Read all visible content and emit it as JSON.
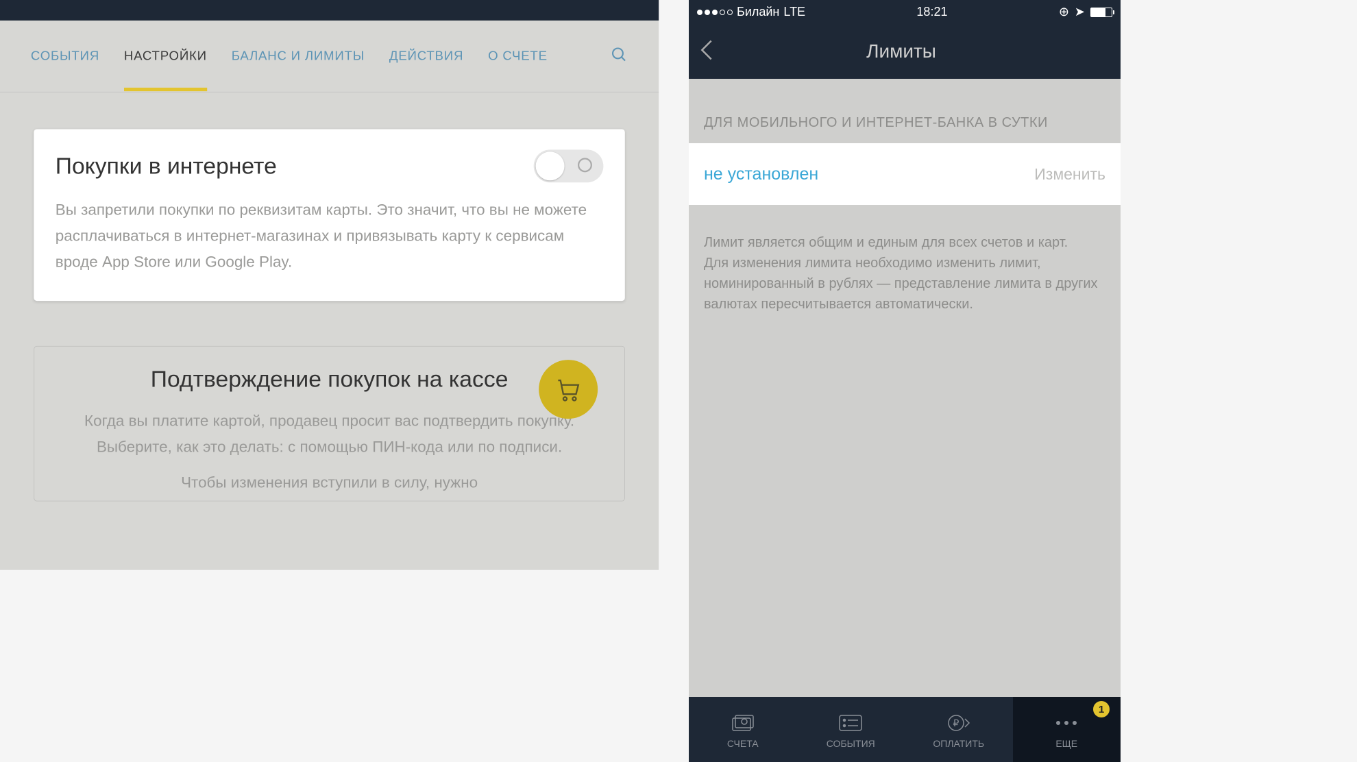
{
  "left": {
    "tabs": [
      "СОБЫТИЯ",
      "НАСТРОЙКИ",
      "БАЛАНС И ЛИМИТЫ",
      "ДЕЙСТВИЯ",
      "О СЧЕТЕ"
    ],
    "activeTab": 1,
    "card1": {
      "title": "Покупки в интернете",
      "desc": "Вы запретили покупки по реквизитам карты. Это значит, что вы не можете расплачиваться в интернет-магазинах и привязывать карту к сервисам вроде App Store или Google Play.",
      "toggle": false
    },
    "card2": {
      "title": "Подтверждение покупок на кассе",
      "desc": "Когда вы платите картой, продавец просит вас подтвердить покупку. Выберите, как это делать: с помощью ПИН-кода или по подписи.",
      "desc2": "Чтобы изменения вступили в силу, нужно"
    }
  },
  "right": {
    "status": {
      "carrier": "Билайн",
      "network": "LTE",
      "time": "18:21"
    },
    "navTitle": "Лимиты",
    "sectionHeader": "ДЛЯ МОБИЛЬНОГО И ИНТЕРНЕТ-БАНКА В СУТКИ",
    "limit": {
      "value": "не установлен",
      "action": "Изменить"
    },
    "sectionFooter": "Лимит является общим и единым для всех счетов и карт.\nДля изменения лимита необходимо изменить лимит, номинированный в рублях — представление лимита в других валютах пересчитывается автоматически.",
    "tabbar": [
      "СЧЕТА",
      "СОБЫТИЯ",
      "ОПЛАТИТЬ",
      "ЕЩЕ"
    ],
    "badge": "1"
  }
}
